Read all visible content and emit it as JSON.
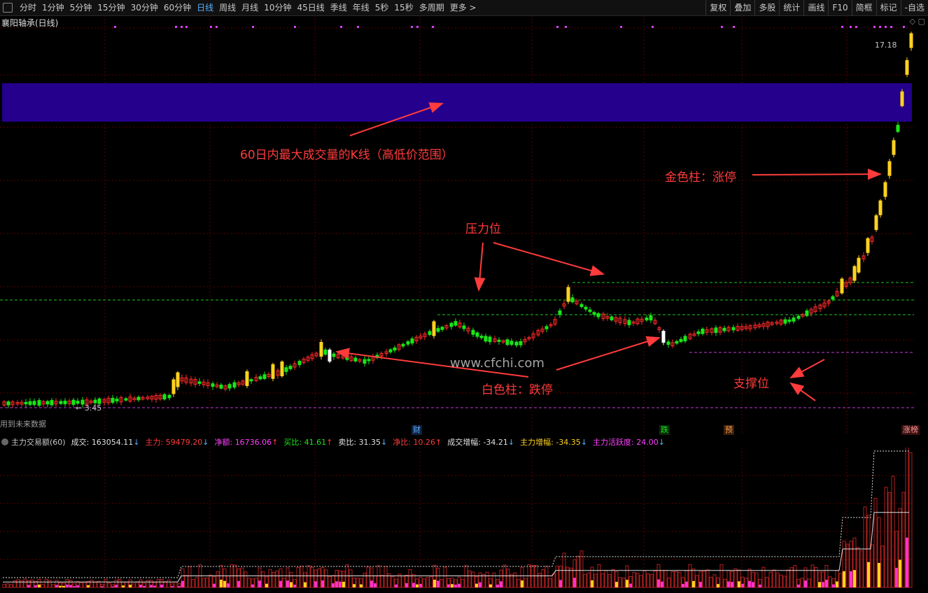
{
  "toolbar": {
    "periods": [
      "分时",
      "1分钟",
      "5分钟",
      "15分钟",
      "30分钟",
      "60分钟",
      "日线",
      "周线",
      "月线",
      "10分钟",
      "45日线",
      "季线",
      "年线",
      "5秒",
      "15秒",
      "多周期",
      "更多 >"
    ],
    "active_period": "日线",
    "tools": [
      "复权",
      "叠加",
      "多股",
      "统计",
      "画线",
      "F10",
      "简框",
      "标记",
      "-自选"
    ]
  },
  "stock_title": "襄阳轴承(日线)",
  "price_labels": {
    "high": "17.18",
    "low": "← 3.45"
  },
  "future_data_note": "用到未来数据",
  "annotations": {
    "zone": "60日内最大成交量的K线（高低价范围）",
    "gold": "金色柱：涨停",
    "pressure": "压力位",
    "white": "白色柱：跌停",
    "support": "支撑位"
  },
  "watermark": "www.cfchi.com",
  "events": [
    "财",
    "跌",
    "预",
    "涨榜"
  ],
  "indicator": {
    "name": "主力交易额(60)",
    "items": [
      {
        "label": "成交:",
        "value": "163054.11",
        "arrow": "↓",
        "color": "white"
      },
      {
        "label": "主力:",
        "value": "59479.20",
        "arrow": "↓",
        "color": "red"
      },
      {
        "label": "净额:",
        "value": "16736.06",
        "arrow": "↑",
        "color": "magenta"
      },
      {
        "label": "买比:",
        "value": "41.61",
        "arrow": "↑",
        "color": "green"
      },
      {
        "label": "卖比:",
        "value": "31.35",
        "arrow": "↓",
        "color": "white"
      },
      {
        "label": "净比:",
        "value": "10.26",
        "arrow": "↑",
        "color": "red"
      },
      {
        "label": "成交增幅:",
        "value": "-34.21",
        "arrow": "↓",
        "color": "white"
      },
      {
        "label": "主力增幅:",
        "value": "-34.35",
        "arrow": "↓",
        "color": "yellow"
      },
      {
        "label": "主力活跃度:",
        "value": "24.00",
        "arrow": "↓",
        "color": "magenta"
      }
    ]
  },
  "colors": {
    "zone": "#24008c",
    "up": "#ff2a2a",
    "down": "#19e619",
    "limit_up": "#ffd21e",
    "limit_down": "#ffffff",
    "pressure": "#1fc61f",
    "support": "#c23bd6",
    "annotation": "#ff3b3b"
  }
}
